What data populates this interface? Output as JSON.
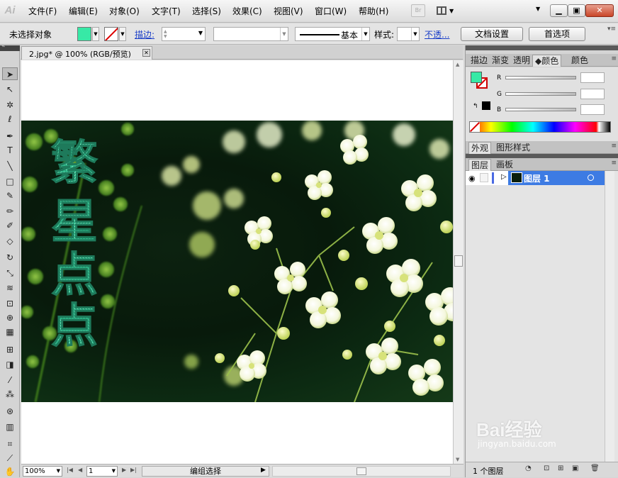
{
  "app": {
    "logo": "Ai"
  },
  "menu": [
    "文件(F)",
    "编辑(E)",
    "对象(O)",
    "文字(T)",
    "选择(S)",
    "效果(C)",
    "视图(V)",
    "窗口(W)",
    "帮助(H)"
  ],
  "titlebar": {
    "bridge": "Br"
  },
  "control_bar": {
    "selection_state": "未选择对象",
    "fill_color": "#37e9a6",
    "stroke_label": "描边:",
    "brush_label": "基本",
    "style_label": "样式:",
    "opacity_label": "不透...",
    "doc_settings": "文档设置",
    "preferences": "首选项"
  },
  "document": {
    "tab_title": "2.jpg* @ 100% (RGB/预览)",
    "artwork_text": [
      "繁",
      "星",
      "点",
      "点"
    ],
    "text_color": "#2fb88a"
  },
  "status": {
    "zoom": "100%",
    "page": "1",
    "text": "编组选择"
  },
  "panels": {
    "color_tabs": [
      "描边",
      "渐变",
      "透明",
      "颜色",
      "颜色"
    ],
    "active_tab": "颜色",
    "rgb_labels": [
      "R",
      "G",
      "B"
    ],
    "appearance_tabs": [
      "外观",
      "图形样式"
    ],
    "layers_tabs": [
      "图层",
      "画板"
    ],
    "layer_name": "图层 1",
    "layer_count": "1 个图层"
  },
  "watermark": {
    "brand": "Bai经验",
    "url": "jingyan.baidu.com"
  }
}
